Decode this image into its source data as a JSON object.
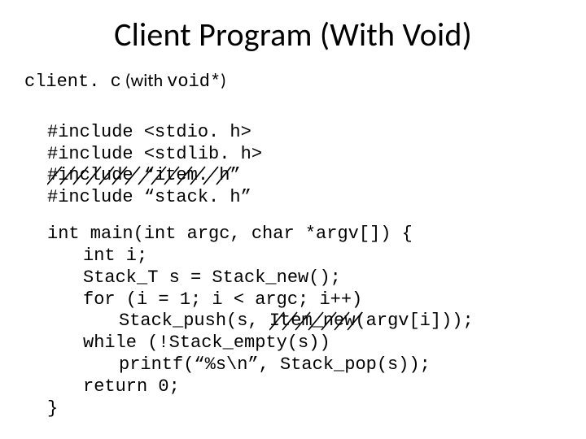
{
  "title": "Client Program (With Void)",
  "sub_prefix": "client. c",
  "sub_paren_open": " (with ",
  "sub_code": "void*",
  "sub_paren_close": ")",
  "code": {
    "l1": "#include <stdio. h>",
    "l2": "#include <stdlib. h>",
    "l3": "#include “item. h”",
    "l4": "#include “stack. h”",
    "l5": "int main(int argc, char *argv[]) {",
    "l6": "int i;",
    "l7": "Stack_T s = Stack_new();",
    "l8": "for (i = 1; i < argc; i++)",
    "l9a": "Stack_push(s, ",
    "l9b": "Item_new(",
    "l9c": "argv[i]));",
    "l10": "while (!Stack_empty(s))",
    "l11": "printf(“%s\\n”, Stack_pop(s));",
    "l12": "return 0;",
    "l13": "}"
  }
}
